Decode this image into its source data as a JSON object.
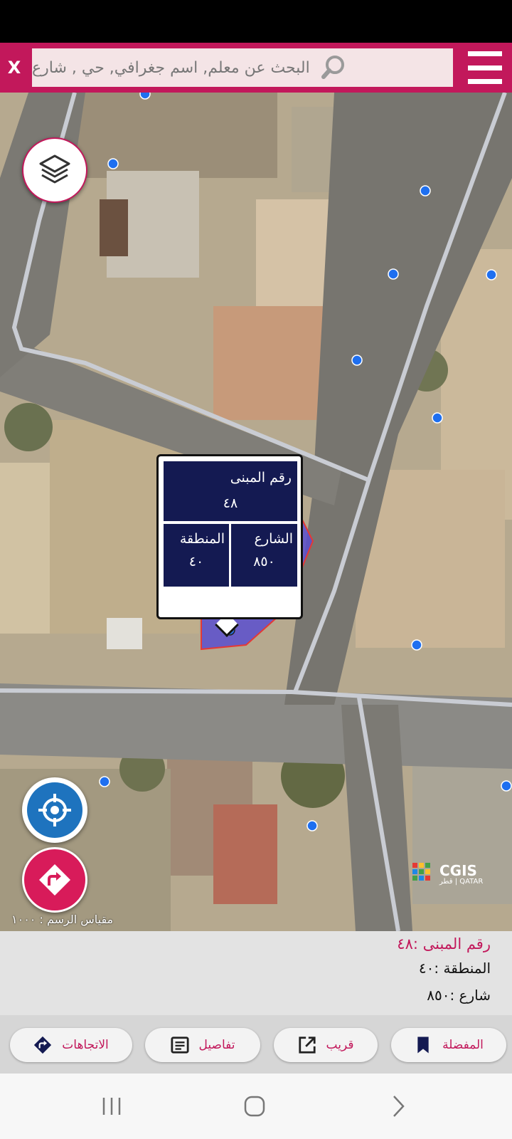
{
  "search": {
    "close_label": "X",
    "placeholder": "البحث عن معلم, اسم جغرافي, حي , شارع",
    "icon": "search-icon",
    "menu_icon": "hamburger-menu-icon"
  },
  "map": {
    "layers_icon": "layers-icon",
    "locate_icon": "crosshair-icon",
    "route_icon": "directions-icon",
    "scale_label": "مقياس الرسم : ١٠٠٠",
    "logo": {
      "text": "CGIS",
      "subtext": "قطر | QATAR"
    },
    "colors": {
      "parcel_fill": "#5a4fcf",
      "parcel_border": "#e53935",
      "marker": "#1e6ff0",
      "road": "#c9ccd3"
    }
  },
  "popup": {
    "building_label": "رقم المبنى",
    "building_value": "٤٨",
    "street_label": "الشارع",
    "street_value": "٨٥٠",
    "zone_label": "المنطقة",
    "zone_value": "٤٠"
  },
  "info": {
    "title": "رقم المبنى :٤٨",
    "zone": "المنطقة :٤٠",
    "street": "شارع :٨٥٠"
  },
  "actions": {
    "favorites": {
      "label": "المفضلة",
      "icon": "bookmark-icon"
    },
    "nearby": {
      "label": "قريب",
      "icon": "open-external-icon"
    },
    "details": {
      "label": "تفاصيل",
      "icon": "details-icon"
    },
    "directions": {
      "label": "الاتجاهات",
      "icon": "directions-icon"
    }
  },
  "nav": {
    "recent_icon": "recent-apps-icon",
    "home_icon": "home-icon",
    "back_icon": "back-icon"
  },
  "accent_color": "#c2185b"
}
